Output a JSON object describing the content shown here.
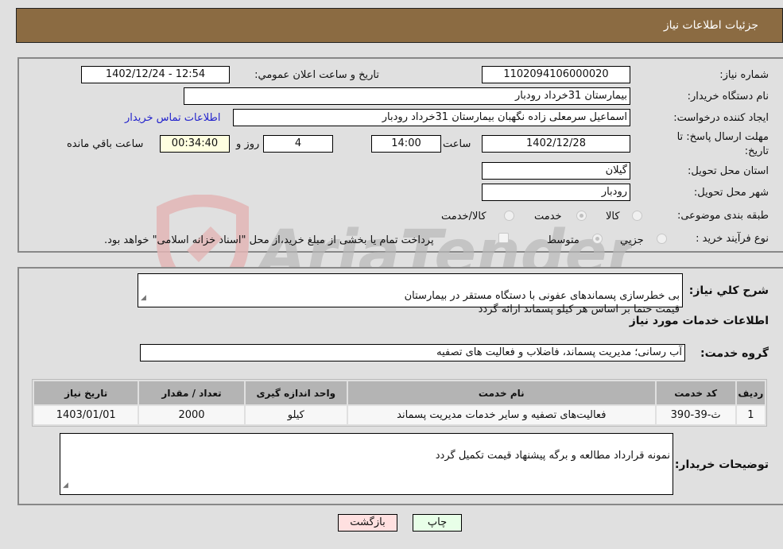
{
  "header": {
    "title": "جزئیات اطلاعات نیاز"
  },
  "details": {
    "need_number_label": "شماره نیاز:",
    "need_number": "1102094106000020",
    "announce_label": "تاریخ و ساعت اعلان عمومي:",
    "announce_value": "1402/12/24 - 12:54",
    "buyer_org_label": "نام دستگاه خریدار:",
    "buyer_org": "بیمارستان 31خرداد رودبار",
    "creator_label": "ایجاد کننده درخواست:",
    "creator": "اسماعیل سرمعلی زاده نگهبان بیمارستان 31خرداد رودبار",
    "buyer_contact_link": "اطلاعات تماس خریدار",
    "deadline_label_line1": "مهلت ارسال پاسخ: تا",
    "deadline_label_line2": "تاریخ:",
    "deadline_date": "1402/12/28",
    "time_label": "ساعت",
    "deadline_time": "14:00",
    "days_value": "4",
    "days_label": "روز و",
    "remaining_time": "00:34:40",
    "remaining_label": "ساعت باقي مانده",
    "province_label": "استان محل تحویل:",
    "province": "گیلان",
    "city_label": "شهر محل تحویل:",
    "city": "رودبار",
    "category_label": "طبقه بندی موضوعی:",
    "category_options": [
      {
        "label": "کالا",
        "checked": false
      },
      {
        "label": "خدمت",
        "checked": true
      },
      {
        "label": "کالا/خدمت",
        "checked": false
      }
    ],
    "process_label": "نوع فرآیند خرید :",
    "process_options": [
      {
        "label": "جزيي",
        "checked": false
      },
      {
        "label": "متوسط",
        "checked": true
      }
    ],
    "treasury_note": "پرداخت تمام یا بخشی از مبلغ خرید،از محل \"اسناد خزانه اسلامی\" خواهد بود.",
    "treasury_checked": false
  },
  "description": {
    "label": "شرح کلي نياز:",
    "text": "بی خطرسازی پسماندهای عفونی با دستگاه مستقر در بیمارستان\nقیمت حتما بر اساس هر کیلو پسماند ارائه گردد"
  },
  "services_section": {
    "title": "اطلاعات خدمات مورد نیاز",
    "group_label": "گروه خدمت:",
    "group_value": "آب رسانی؛ مدیریت پسماند، فاضلاب و فعالیت های تصفیه"
  },
  "table": {
    "headers": [
      "ردیف",
      "کد خدمت",
      "نام خدمت",
      "واحد اندازه گیری",
      "تعداد / مقدار",
      "تاریخ نیاز"
    ],
    "rows": [
      [
        "1",
        "ث-39-390",
        "فعالیت‌های تصفیه و سایر خدمات مدیریت پسماند",
        "کیلو",
        "2000",
        "1403/01/01"
      ]
    ]
  },
  "buyer_notes": {
    "label": "توضیحات خریدار:",
    "text": "نمونه قرارداد مطالعه و برگه پیشنهاد قیمت تکمیل گردد"
  },
  "buttons": {
    "print": "چاپ",
    "back": "بازگشت"
  },
  "watermark": {
    "text": "AriaTender.neT",
    "shield_color": "#e2b5b5",
    "text_color": "#b9b9b9"
  }
}
